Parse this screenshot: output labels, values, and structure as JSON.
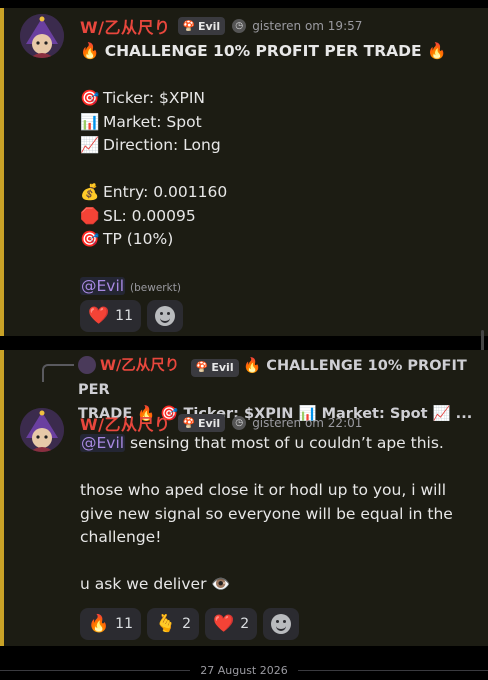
{
  "message1": {
    "username": "W/乙从尺り",
    "role_tag": "Evil",
    "timestamp": "gisteren om 19:57",
    "title": "🔥 CHALLENGE 10% PROFIT PER TRADE 🔥",
    "lines": [
      {
        "emoji": "🎯",
        "text": "Ticker:  $XPIN"
      },
      {
        "emoji": "📊",
        "text": "Market: Spot"
      },
      {
        "emoji": "📈",
        "text": "Direction: Long"
      },
      {
        "emoji": "💰",
        "text": "Entry: 0.001160"
      },
      {
        "emoji": "🛑",
        "text": "SL: 0.00095"
      },
      {
        "emoji": "🎯",
        "text": "TP (10%)"
      }
    ],
    "mention": "@Evil",
    "edited": "(bewerkt)",
    "reactions": [
      {
        "emoji": "❤️",
        "count": "11"
      }
    ]
  },
  "message2": {
    "reply_preview": {
      "username": "W/乙从尺り",
      "role_tag": "Evil",
      "text_line1": "🔥 CHALLENGE 10% PROFIT PER",
      "text_line2": "TRADE 🔥 🎯 Ticker:  $XPIN 📊 Market: Spot  📈 ..."
    },
    "username": "W/乙从尺り",
    "role_tag": "Evil",
    "timestamp": "gisteren om 22:01",
    "mention": "@Evil",
    "text1": " sensing that most of u couldn’t ape this.",
    "text2": "those who aped close it or hodl up to you, i will give new signal so everyone will be equal in the challenge!",
    "text3": "u ask we deliver 👁️",
    "reactions": [
      {
        "emoji": "🔥",
        "count": "11"
      },
      {
        "emoji": "🫰",
        "count": "2"
      },
      {
        "emoji": "❤️",
        "count": "2"
      }
    ]
  },
  "date_divider": "27 August 2026",
  "colors": {
    "username": "#e8473d",
    "mention": "#a788e0",
    "highlight_border": "#c9a227",
    "highlight_bg": "#1c1c13"
  },
  "icons": {
    "role_tag": "mushroom-icon",
    "clock": "clock-icon",
    "add_reaction": "add-reaction-icon"
  }
}
